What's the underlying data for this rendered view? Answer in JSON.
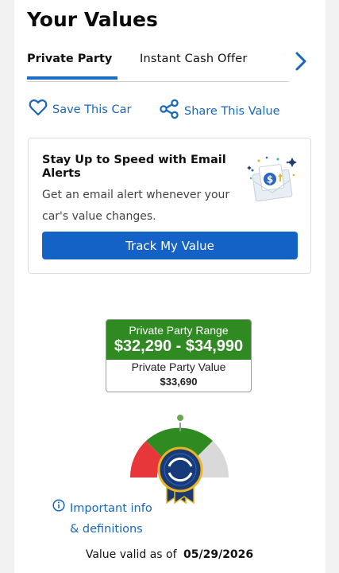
{
  "header": {
    "title": "Your Values"
  },
  "tabs": [
    {
      "label": "Private Party",
      "active": true
    },
    {
      "label": "Instant Cash Offer",
      "active": false
    },
    {
      "label": "T",
      "active": false
    }
  ],
  "actions": {
    "save_label": "Save This Car",
    "share_label": "Share This Value"
  },
  "alert": {
    "title": "Stay Up to Speed with Email Alerts",
    "text": "Get an email alert whenever your car's value changes.",
    "button_label": "Track My Value"
  },
  "valuation": {
    "range_label": "Private Party Range",
    "range_value": "$32,290 - $34,990",
    "value_label": "Private Party Value",
    "value": "$33,690"
  },
  "info": {
    "line1": "Important info",
    "line2": "& definitions"
  },
  "validity": {
    "prefix": "Value valid as of",
    "date": "05/29/2026"
  },
  "colors": {
    "accent_blue": "#1462c5",
    "link_blue": "#1a66b8",
    "range_green": "#2f8a22",
    "gauge_red": "#e8373a",
    "gauge_gray": "#d9d9d9",
    "ribbon_navy": "#1d3a6e",
    "ribbon_gold": "#e8b526"
  },
  "icons": [
    "chevron-right-icon",
    "heart-icon",
    "share-icon",
    "email-envelope-icon",
    "info-icon",
    "award-ribbon-icon"
  ]
}
